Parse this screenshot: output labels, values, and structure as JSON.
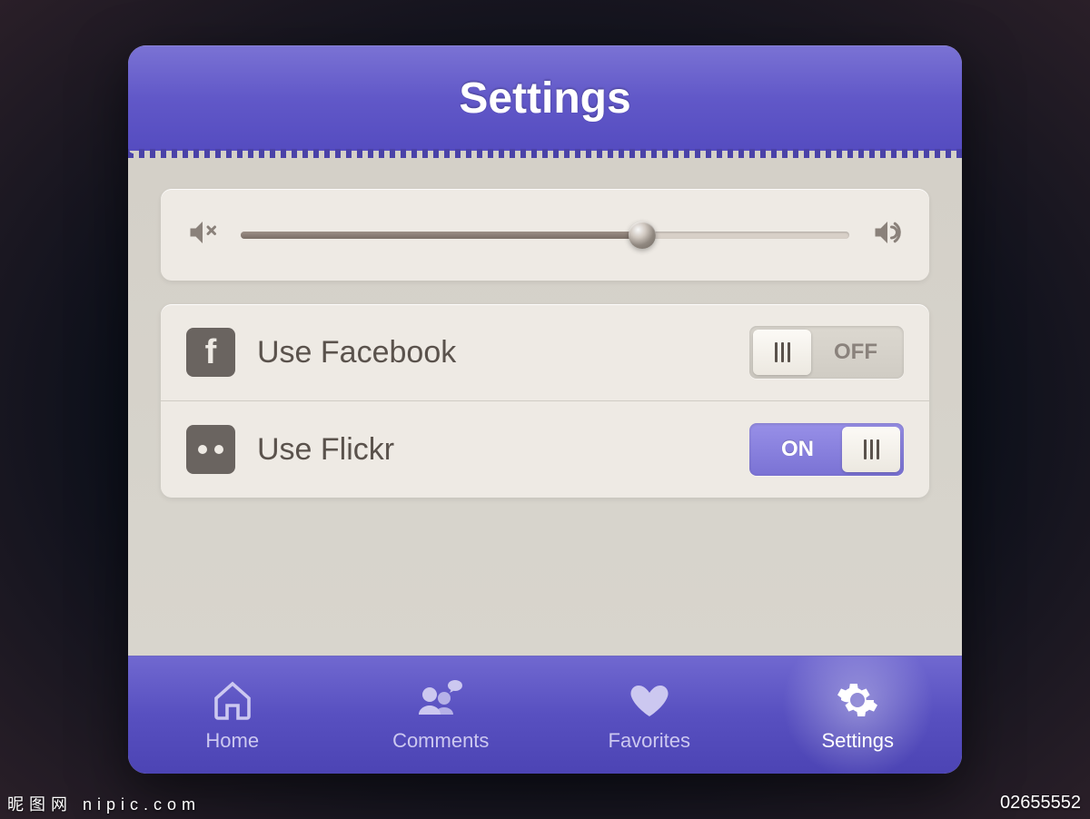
{
  "header": {
    "title": "Settings"
  },
  "volume": {
    "value_percent": 66
  },
  "social": {
    "facebook": {
      "label": "Use Facebook",
      "toggle_state": "OFF"
    },
    "flickr": {
      "label": "Use Flickr",
      "toggle_state": "ON"
    }
  },
  "tabs": {
    "home": "Home",
    "comments": "Comments",
    "favorites": "Favorites",
    "settings": "Settings"
  },
  "watermark": {
    "left": "昵图网 nipic.com",
    "right": "02655552"
  }
}
